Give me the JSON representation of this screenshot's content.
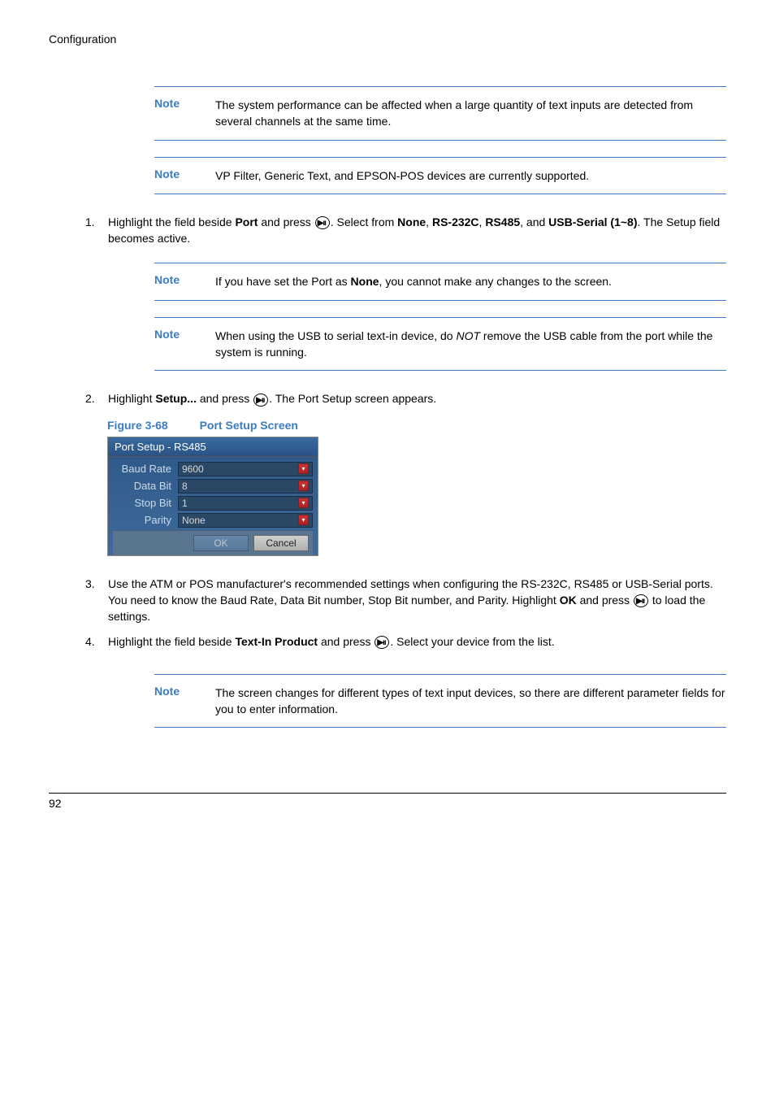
{
  "header": "Configuration",
  "notes": {
    "label": "Note",
    "note1": "The system performance can be affected when a large quantity of text inputs are detected from several channels at the same time.",
    "note2": "VP Filter, Generic Text, and EPSON-POS devices are currently supported.",
    "note3_pre": "If you have set the Port as ",
    "note3_bold": "None",
    "note3_post": ", you cannot make any changes to the screen.",
    "note4_pre": "When using the USB to serial text-in device, do ",
    "note4_italic": "NOT",
    "note4_post": " remove the USB cable from the port while the system is running.",
    "note5": "The screen changes for different types of text input devices, so there are different parameter fields for you to enter information."
  },
  "steps": {
    "s1": {
      "num": "1.",
      "t1": "Highlight the field beside ",
      "b1": "Port",
      "t2": " and press ",
      "t3": ". Select from ",
      "b2": "None",
      "comma1": ", ",
      "b3": "RS-232C",
      "comma2": ", ",
      "b4": "RS485",
      "t4": ", and ",
      "b5": "USB-Serial (1~8)",
      "t5": ". The Setup field becomes active."
    },
    "s2": {
      "num": "2.",
      "t1": "Highlight ",
      "b1": "Setup...",
      "t2": " and press ",
      "t3": ". The Port Setup screen appears."
    },
    "s3": {
      "num": "3.",
      "t1": "Use the ATM or POS manufacturer's recommended settings when configuring the RS-232C, RS485 or USB-Serial ports. You need to know the Baud Rate, Data Bit number, Stop Bit number, and Parity. Highlight ",
      "b1": "OK",
      "t2": " and press ",
      "t3": " to load the settings."
    },
    "s4": {
      "num": "4.",
      "t1": "Highlight the field beside ",
      "b1": "Text-In Product",
      "t2": " and press ",
      "t3": ". Select your device from the list."
    }
  },
  "figure": {
    "num": "Figure 3-68",
    "title": "Port Setup Screen"
  },
  "portSetup": {
    "title": "Port Setup - RS485",
    "rows": {
      "baudLabel": "Baud Rate",
      "baudValue": "9600",
      "dataBitLabel": "Data Bit",
      "dataBitValue": "8",
      "stopBitLabel": "Stop Bit",
      "stopBitValue": "1",
      "parityLabel": "Parity",
      "parityValue": "None"
    },
    "okBtn": "OK",
    "cancelBtn": "Cancel"
  },
  "footer": {
    "page": "92"
  },
  "iconGlyph": "▶/II"
}
